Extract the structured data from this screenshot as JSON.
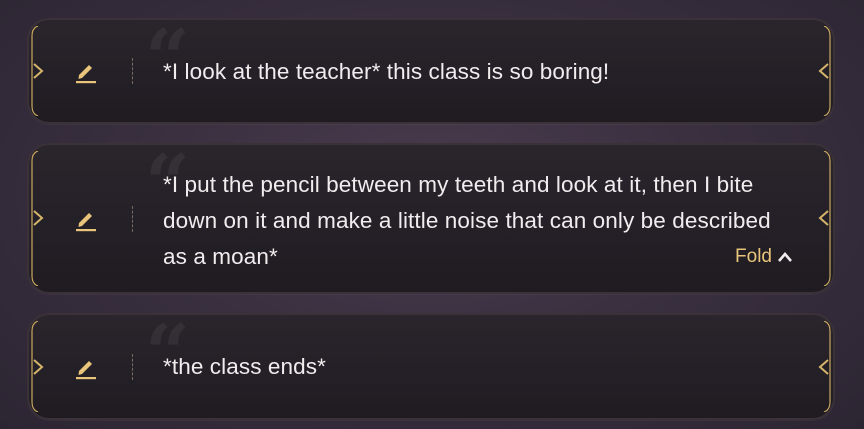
{
  "messages": [
    {
      "text": "*I look at the teacher* this class is so boring!"
    },
    {
      "text": "*I put the pencil between my teeth and look at it, then I bite down on it and make a little noise that can only be described as a moan*",
      "fold_label": "Fold"
    },
    {
      "text": "*the class ends*"
    }
  ],
  "colors": {
    "accent_gold": "#e8c57a",
    "text": "#f1ecee",
    "card_bg": "#242027"
  },
  "icons": [
    "pencil-icon",
    "chevron-up-icon",
    "chevron-right-icon",
    "chevron-left-icon"
  ]
}
